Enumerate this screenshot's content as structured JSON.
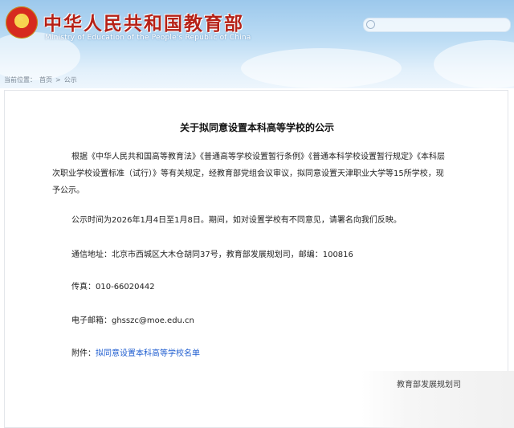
{
  "header": {
    "title_cn": "中华人民共和国教育部",
    "title_en": "Ministry of Education of the People's Republic of China",
    "search_placeholder": ""
  },
  "breadcrumb": {
    "label": "当前位置：",
    "home": "首页",
    "separator": ">",
    "current": "公示"
  },
  "article": {
    "title": "关于拟同意设置本科高等学校的公示",
    "paragraph1_lines": [
      "根据《中华人民共和国高等教育法》《普通高等学校设置暂行条例》《普通本科学校设置暂行规定》《本科层",
      "次职业学校设置标准（试行）》等有关规定，经教育部党组会议审议，拟同意设置天津职业大学等15所学校，现",
      "予公示。"
    ],
    "period": "公示时间为2026年1月4日至1月8日。期间，如对设置学校有不同意见，请署名向我们反映。",
    "address": "通信地址：北京市西城区大木仓胡同37号，教育部发展规划司，邮编：100816",
    "fax": "传真：010-66020442",
    "email": "电子邮箱：ghsszc@moe.edu.cn",
    "attachment_label": "附件：",
    "attachment_link": "拟同意设置本科高等学校名单",
    "signature": "教育部发展规划司"
  },
  "colors": {
    "title_red": "#b52117",
    "link_blue": "#1f5ed0"
  }
}
